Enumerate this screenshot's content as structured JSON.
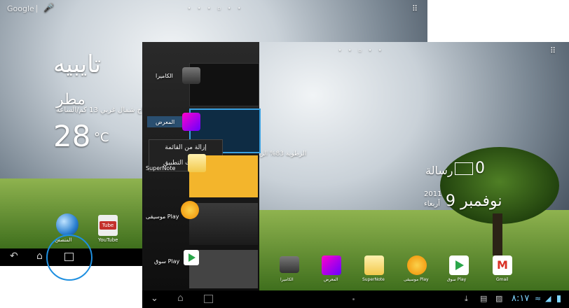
{
  "screen_a": {
    "google_label": "Google",
    "city": "تايبيه",
    "weather": "مطر",
    "wind": "رياح شمال غربي 13 كم/الساعة",
    "temp": "28",
    "unit": "°C",
    "apps": [
      {
        "label": "المتصفح",
        "icon": "browser-globe-icon"
      },
      {
        "label": "YouTube",
        "icon": "youtube-icon"
      }
    ]
  },
  "screen_b": {
    "humidity": "الرطوبة 83% الرياح غرب شمال",
    "messages_count": "0",
    "messages_label": "رسالة",
    "date": "نوفمبر 9",
    "year": "2011",
    "weekday": "أربعاء",
    "recent_apps": [
      {
        "label": "الكاميرا",
        "icon": "camera-icon"
      },
      {
        "label": "المعرض",
        "icon": "gallery-icon"
      },
      {
        "label": "SuperNote",
        "icon": "supernote-icon"
      },
      {
        "label": "موسيقى Play",
        "icon": "headphones-icon"
      },
      {
        "label": "سوق Play",
        "icon": "play-store-icon"
      }
    ],
    "context_menu": [
      "إزالة من القائمة",
      "معلومات التطبيق"
    ],
    "dock": [
      {
        "label": "الكاميرا",
        "icon": "camera-icon"
      },
      {
        "label": "المعرض",
        "icon": "gallery-icon"
      },
      {
        "label": "SuperNote",
        "icon": "supernote-icon"
      },
      {
        "label": "موسيقى Play",
        "icon": "headphones-icon"
      },
      {
        "label": "سوق Play",
        "icon": "play-store-icon"
      },
      {
        "label": "Gmail",
        "icon": "gmail-icon"
      }
    ],
    "clock": "٨:١٧"
  }
}
